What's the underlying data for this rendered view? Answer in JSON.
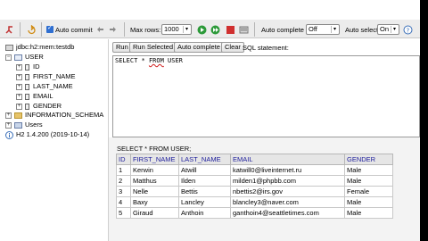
{
  "toolbar": {
    "auto_commit_label": "Auto commit",
    "max_rows_label": "Max rows:",
    "max_rows_value": "1000",
    "auto_complete_label": "Auto complete",
    "auto_complete_value": "Off",
    "auto_select_label": "Auto select",
    "auto_select_value": "On"
  },
  "tree": {
    "connection": "jdbc:h2:mem:testdb",
    "table": "USER",
    "columns": [
      "ID",
      "FIRST_NAME",
      "LAST_NAME",
      "EMAIL",
      "GENDER"
    ],
    "schema": "INFORMATION_SCHEMA",
    "users": "Users",
    "version": "H2 1.4.200 (2019-10-14)"
  },
  "buttons": {
    "run": "Run",
    "run_selected": "Run Selected",
    "auto_complete": "Auto complete",
    "clear": "Clear",
    "sql_statement_label": "SQL statement:"
  },
  "sql": {
    "prefix": "SELECT * ",
    "kw": "FROM",
    "suffix": " USER"
  },
  "result": {
    "query": "SELECT * FROM USER;",
    "headers": [
      "ID",
      "FIRST_NAME",
      "LAST_NAME",
      "EMAIL",
      "GENDER"
    ],
    "rows": [
      [
        "1",
        "Kerwin",
        "Atwill",
        "katwill0@liveinternet.ru",
        "Male"
      ],
      [
        "2",
        "Matthus",
        "Ilden",
        "milden1@phpbb.com",
        "Male"
      ],
      [
        "3",
        "Nelle",
        "Bettis",
        "nbettis2@irs.gov",
        "Female"
      ],
      [
        "4",
        "Baxy",
        "Lancley",
        "blancley3@naver.com",
        "Male"
      ],
      [
        "5",
        "Giraud",
        "Anthoin",
        "ganthoin4@seattletimes.com",
        "Male"
      ]
    ]
  }
}
